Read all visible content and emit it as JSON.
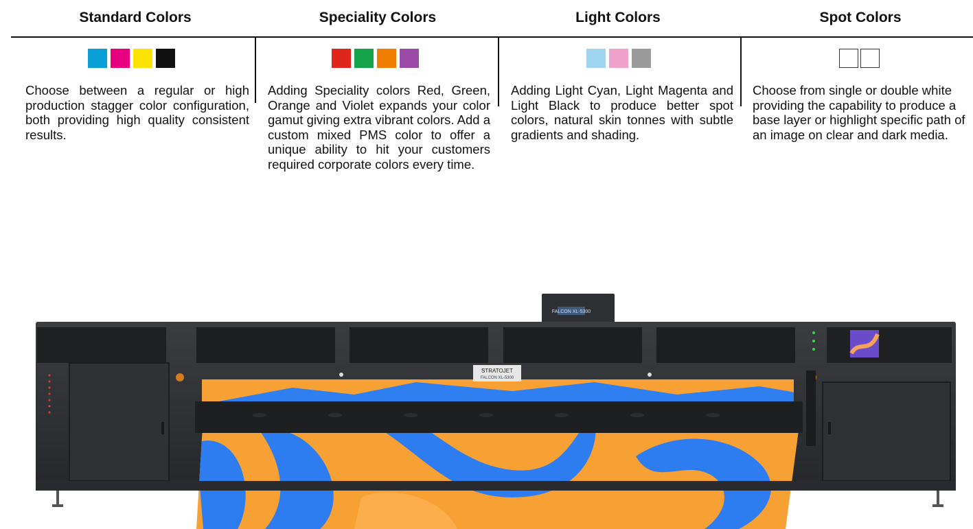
{
  "columns": [
    {
      "title": "Standard Colors",
      "swatches": [
        "#0aa0d7",
        "#e6007e",
        "#ffe300",
        "#111111"
      ],
      "text": "Choose between a regular or high production stagger color configuration, both providing high quality consistent results."
    },
    {
      "title": "Speciality Colors",
      "swatches": [
        "#e0261c",
        "#16a34a",
        "#f07c00",
        "#9b4aa8"
      ],
      "text": "Adding Speciality colors Red, Green, Orange and Violet expands your color gamut giving extra vibrant colors. Add a custom mixed PMS color to offer a unique ability to hit your customers required corporate colors every time."
    },
    {
      "title": "Light Colors",
      "swatches": [
        "#9fd4ef",
        "#efa3cc",
        "#9a9a9a"
      ],
      "text": "Adding Light Cyan, Light Magenta and Light Black to produce better spot colors, natural skin tonnes with subtle gradients and shading."
    },
    {
      "title": "Spot Colors",
      "swatches": [
        "#ffffff",
        "#ffffff"
      ],
      "text": "Choose from single or double white providing the capability to produce a base layer or highlight specific path of an image on clear and dark media."
    }
  ],
  "printer": {
    "brand_label": "STRATOJET",
    "model_label": "FALCON XL-5300",
    "top_label": "FALCON XL-5300"
  }
}
